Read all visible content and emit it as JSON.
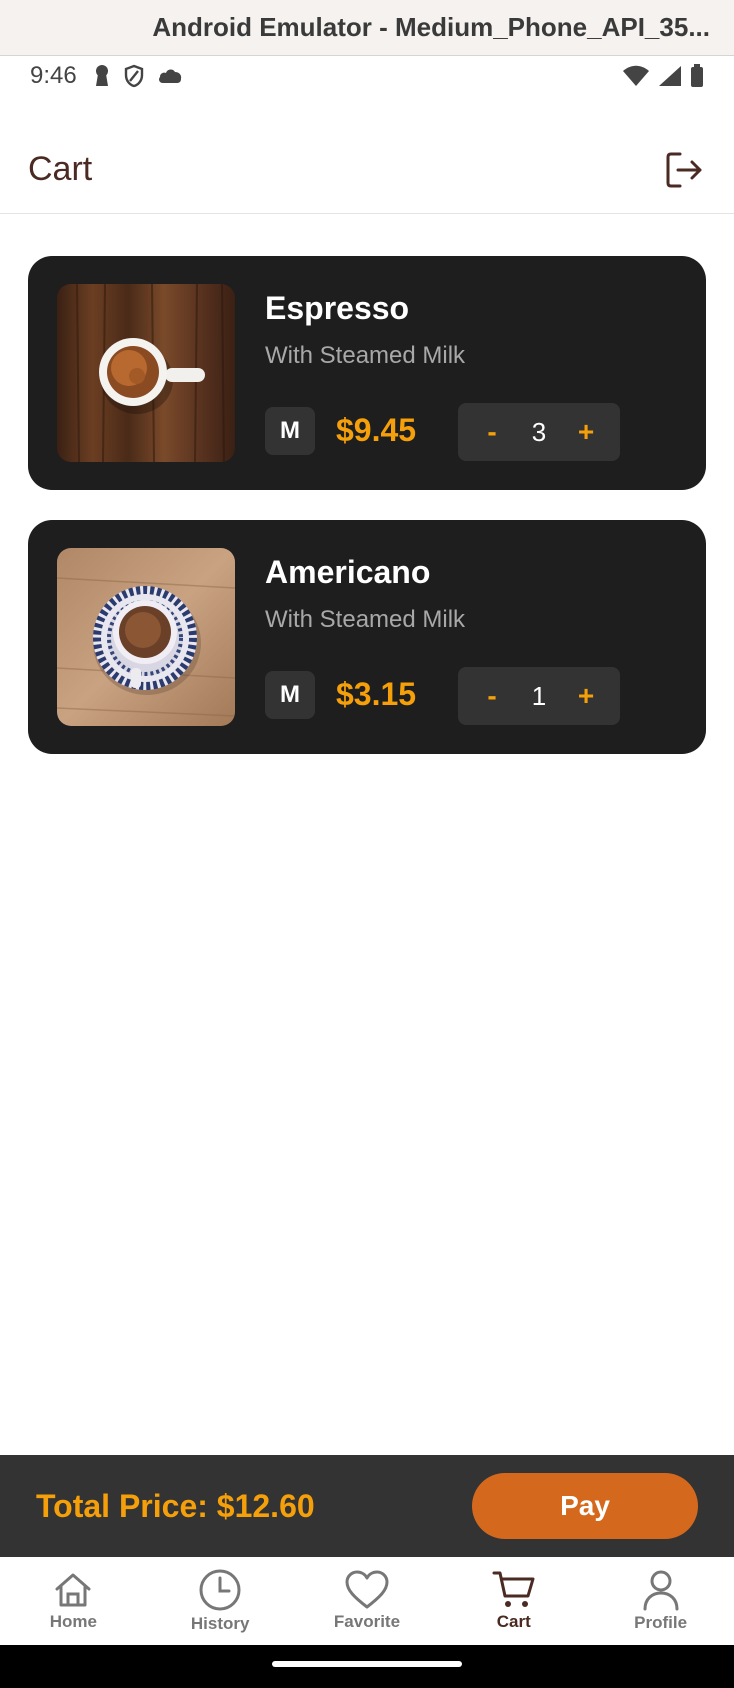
{
  "window": {
    "title": "Android Emulator - Medium_Phone_API_35..."
  },
  "status_bar": {
    "time": "9:46",
    "left_icons": [
      "keyhole-icon",
      "shield-icon",
      "cloud-icon"
    ],
    "right_icons": [
      "wifi-icon",
      "signal-icon",
      "battery-icon"
    ]
  },
  "header": {
    "title": "Cart",
    "action_icon": "logout-icon"
  },
  "cart": {
    "items": [
      {
        "name": "Espresso",
        "description": "With Steamed Milk",
        "size": "M",
        "price": "$9.45",
        "quantity": "3",
        "minus": "-",
        "plus": "+",
        "image": "espresso-cup"
      },
      {
        "name": "Americano",
        "description": "With Steamed Milk",
        "size": "M",
        "price": "$3.15",
        "quantity": "1",
        "minus": "-",
        "plus": "+",
        "image": "americano-cup"
      }
    ]
  },
  "checkout": {
    "total_label": "Total Price: $12.60",
    "pay_label": "Pay"
  },
  "nav": {
    "items": [
      {
        "label": "Home",
        "icon": "home-icon"
      },
      {
        "label": "History",
        "icon": "clock-icon"
      },
      {
        "label": "Favorite",
        "icon": "heart-icon"
      },
      {
        "label": "Cart",
        "icon": "cart-icon",
        "active": true
      },
      {
        "label": "Profile",
        "icon": "user-icon"
      }
    ]
  },
  "colors": {
    "accent": "#f5a00b",
    "pay_button": "#d4691e",
    "card": "#1e1e1e",
    "title_brown": "#4a2a22"
  }
}
